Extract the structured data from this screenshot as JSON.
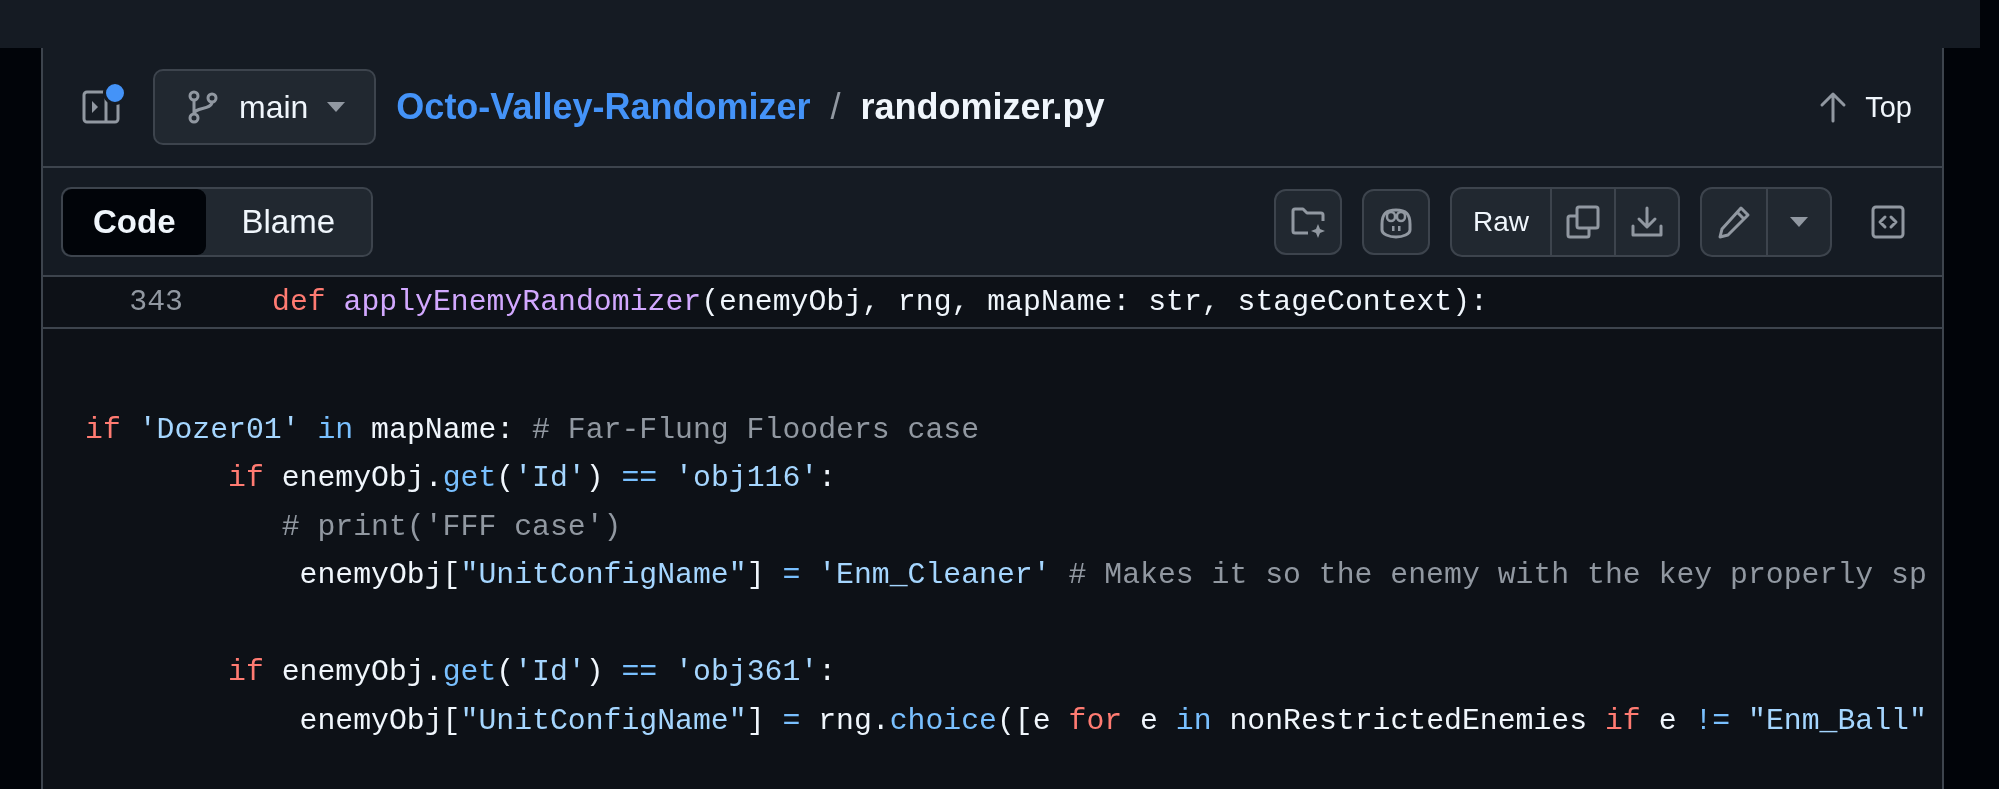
{
  "header": {
    "sidebar_badge": true,
    "branch": "main",
    "repo": "Octo-Valley-Randomizer",
    "separator": "/",
    "file": "randomizer.py",
    "top": "Top"
  },
  "tabs": [
    {
      "label": "Code",
      "selected": true
    },
    {
      "label": "Blame",
      "selected": false
    }
  ],
  "toolbar": {
    "raw": "Raw"
  },
  "sticky_line": {
    "number": "343",
    "tokens": [
      {
        "kind": "kw",
        "text": "def"
      },
      {
        "kind": "fn",
        "text": " applyEnemyRandomizer"
      },
      {
        "kind": "plain",
        "text": "(enemyObj, rng, mapName: str, stageContext):"
      }
    ]
  },
  "code_lines": [
    {
      "kind": "blank"
    },
    {
      "kind": "code",
      "tokens": [
        {
          "kind": "kw",
          "text": "if"
        },
        {
          "kind": "str",
          "text": " 'Dozer01' "
        },
        {
          "kind": "op",
          "text": "in"
        },
        {
          "kind": "plain",
          "text": " mapName: "
        },
        {
          "kind": "cm",
          "text": "# Far-Flung Flooders case"
        }
      ]
    },
    {
      "kind": "code",
      "tokens": [
        {
          "kind": "kw",
          "text": "        if"
        },
        {
          "kind": "plain",
          "text": " enemyObj."
        },
        {
          "kind": "op",
          "text": "get"
        },
        {
          "kind": "plain",
          "text": "("
        },
        {
          "kind": "str",
          "text": "'Id'"
        },
        {
          "kind": "plain",
          "text": ") "
        },
        {
          "kind": "op",
          "text": "=="
        },
        {
          "kind": "str",
          "text": " 'obj116'"
        },
        {
          "kind": "plain",
          "text": ":"
        }
      ]
    },
    {
      "kind": "code",
      "tokens": [
        {
          "kind": "cm",
          "text": "           # print('FFF case')"
        }
      ]
    },
    {
      "kind": "code",
      "tokens": [
        {
          "kind": "plain",
          "text": "            enemyObj["
        },
        {
          "kind": "str",
          "text": "\"UnitConfigName\""
        },
        {
          "kind": "plain",
          "text": "] "
        },
        {
          "kind": "op",
          "text": "="
        },
        {
          "kind": "str",
          "text": " 'Enm_Cleaner' "
        },
        {
          "kind": "cm",
          "text": "# Makes it so the enemy with the key properly sp"
        }
      ]
    },
    {
      "kind": "blank"
    },
    {
      "kind": "code",
      "tokens": [
        {
          "kind": "kw",
          "text": "        if"
        },
        {
          "kind": "plain",
          "text": " enemyObj."
        },
        {
          "kind": "op",
          "text": "get"
        },
        {
          "kind": "plain",
          "text": "("
        },
        {
          "kind": "str",
          "text": "'Id'"
        },
        {
          "kind": "plain",
          "text": ") "
        },
        {
          "kind": "op",
          "text": "=="
        },
        {
          "kind": "str",
          "text": " 'obj361'"
        },
        {
          "kind": "plain",
          "text": ":"
        }
      ]
    },
    {
      "kind": "code",
      "tokens": [
        {
          "kind": "plain",
          "text": "            enemyObj["
        },
        {
          "kind": "str",
          "text": "\"UnitConfigName\""
        },
        {
          "kind": "plain",
          "text": "] "
        },
        {
          "kind": "op",
          "text": "="
        },
        {
          "kind": "plain",
          "text": " rng."
        },
        {
          "kind": "op",
          "text": "choice"
        },
        {
          "kind": "plain",
          "text": "([e "
        },
        {
          "kind": "kw",
          "text": "for"
        },
        {
          "kind": "plain",
          "text": " e "
        },
        {
          "kind": "op",
          "text": "in"
        },
        {
          "kind": "plain",
          "text": " nonRestrictedEnemies "
        },
        {
          "kind": "kw",
          "text": "if"
        },
        {
          "kind": "plain",
          "text": " e "
        },
        {
          "kind": "op",
          "text": "!="
        },
        {
          "kind": "str",
          "text": " \"Enm_Ball\""
        }
      ]
    }
  ]
}
